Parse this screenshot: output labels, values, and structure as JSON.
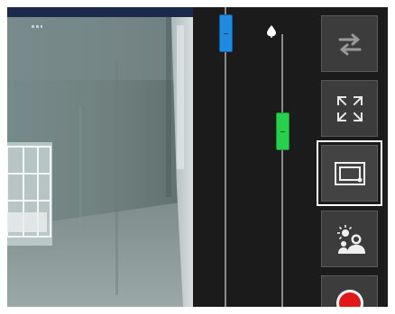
{
  "camera": {
    "feed_label": "camera-feed"
  },
  "sliders": {
    "left_slider": {
      "color": "#1f8be0",
      "position_fraction": 0.05
    },
    "right_slider": {
      "color": "#27d04a",
      "position_fraction": 0.42,
      "icon": "drop-icon"
    }
  },
  "toolbar": {
    "buttons": [
      {
        "name": "swap-button",
        "icon": "swap-arrows-icon",
        "selected": false
      },
      {
        "name": "fullscreen-button",
        "icon": "fullscreen-icon",
        "selected": false
      },
      {
        "name": "picture-in-picture-button",
        "icon": "pip-frame-icon",
        "selected": true
      },
      {
        "name": "scene-detect-button",
        "icon": "scene-people-icon",
        "selected": false
      },
      {
        "name": "record-button",
        "icon": "record-icon",
        "selected": false
      }
    ]
  },
  "colors": {
    "background": "#1b1b1b",
    "button_bg": "#3c3c3c",
    "record_red": "#e01818",
    "selected_outline": "#ffffff"
  }
}
